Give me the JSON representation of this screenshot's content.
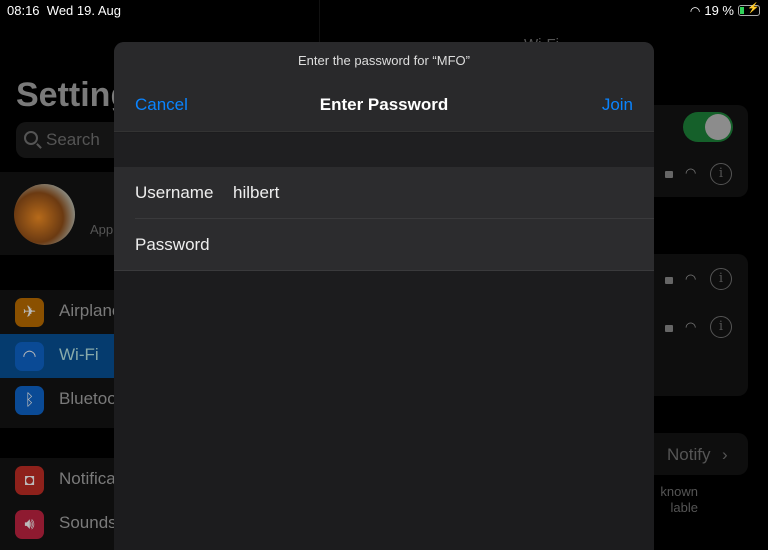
{
  "status": {
    "time": "08:16",
    "date": "Wed 19. Aug",
    "battery": "19 %",
    "battery_level": 19,
    "charging": true
  },
  "sidebar": {
    "title": "Settings",
    "search_placeholder": "Search",
    "profile_subtitle": "App",
    "items": [
      {
        "label": "Airplane Mode",
        "icon": "airplane-icon",
        "color": "#b86a00"
      },
      {
        "label": "Wi-Fi",
        "icon": "wifi-icon",
        "color": "#0b5bb5",
        "selected": true
      },
      {
        "label": "Bluetooth",
        "icon": "bluetooth-icon",
        "color": "#0b5bb5"
      },
      {
        "label": "Notifications",
        "icon": "notifications-icon",
        "color": "#b52a22"
      },
      {
        "label": "Sounds",
        "icon": "sounds-icon",
        "color": "#b51e3a"
      }
    ]
  },
  "detail": {
    "title": "Wi-Fi",
    "wifi_enabled": true,
    "ask_to_join": "Notify",
    "footer": "known\nlable"
  },
  "modal": {
    "prompt": "Enter the password for “MFO”",
    "title": "Enter Password",
    "cancel": "Cancel",
    "join": "Join",
    "username_label": "Username",
    "username_value": "hilbert",
    "password_label": "Password",
    "password_value": ""
  }
}
